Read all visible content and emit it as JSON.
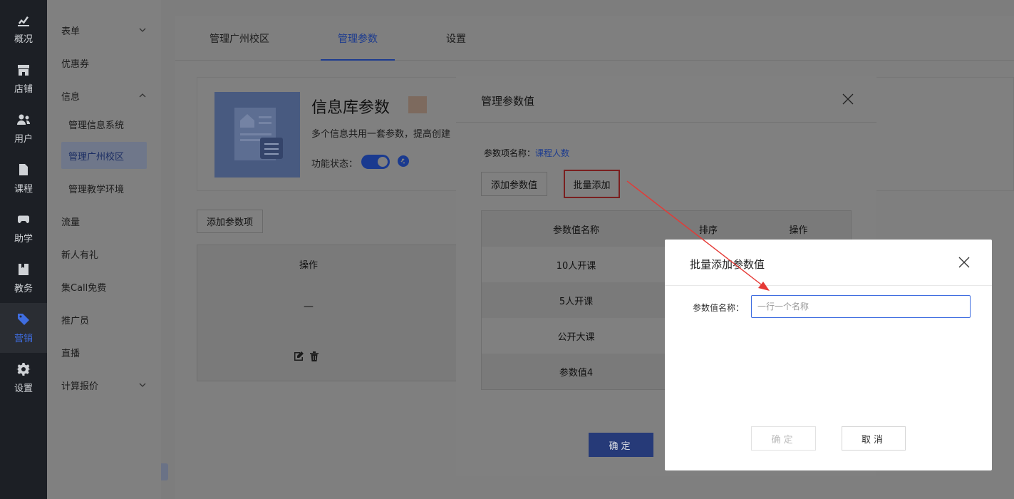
{
  "nav": [
    {
      "label": "概况",
      "icon": "chart-icon"
    },
    {
      "label": "店铺",
      "icon": "store-icon"
    },
    {
      "label": "用户",
      "icon": "users-icon"
    },
    {
      "label": "课程",
      "icon": "document-icon"
    },
    {
      "label": "助学",
      "icon": "gamepad-icon"
    },
    {
      "label": "教务",
      "icon": "book-icon"
    },
    {
      "label": "营销",
      "icon": "tag-icon",
      "active": true
    },
    {
      "label": "设置",
      "icon": "gear-icon"
    }
  ],
  "sidebar": [
    {
      "label": "表单"
    },
    {
      "label": "优惠券"
    },
    {
      "label": "信息"
    },
    {
      "label": "管理信息系统"
    },
    {
      "label": "管理广州校区"
    },
    {
      "label": "管理教学环境"
    },
    {
      "label": "流量"
    },
    {
      "label": "新人有礼"
    },
    {
      "label": "集Call免费"
    },
    {
      "label": "推广员"
    },
    {
      "label": "直播"
    },
    {
      "label": "计算报价"
    }
  ],
  "tabs": [
    {
      "label": "管理广州校区"
    },
    {
      "label": "管理参数"
    },
    {
      "label": "设置"
    }
  ],
  "card": {
    "title": "信息库参数",
    "desc": "多个信息共用一套参数，提高创建",
    "status_label": "功能状态："
  },
  "bg": {
    "add_item": "添加参数项",
    "col_ops": "操作",
    "dash": "—"
  },
  "modal1": {
    "title": "管理参数值",
    "item_label": "参数项名称：",
    "item_value": "课程人数",
    "btn_add": "添加参数值",
    "btn_batch": "批量添加",
    "cols": [
      "参数值名称",
      "排序",
      "操作"
    ],
    "rows": [
      "10人开课",
      "5人开课",
      "公开大课",
      "参数值4"
    ],
    "ok": "确定"
  },
  "modal2": {
    "title": "批量添加参数值",
    "label": "参数值名称：",
    "placeholder": "一行一个名称",
    "ok": "确定",
    "cancel": "取消"
  },
  "colors": {
    "accent": "#3f6de0",
    "annotation": "#e53935"
  }
}
